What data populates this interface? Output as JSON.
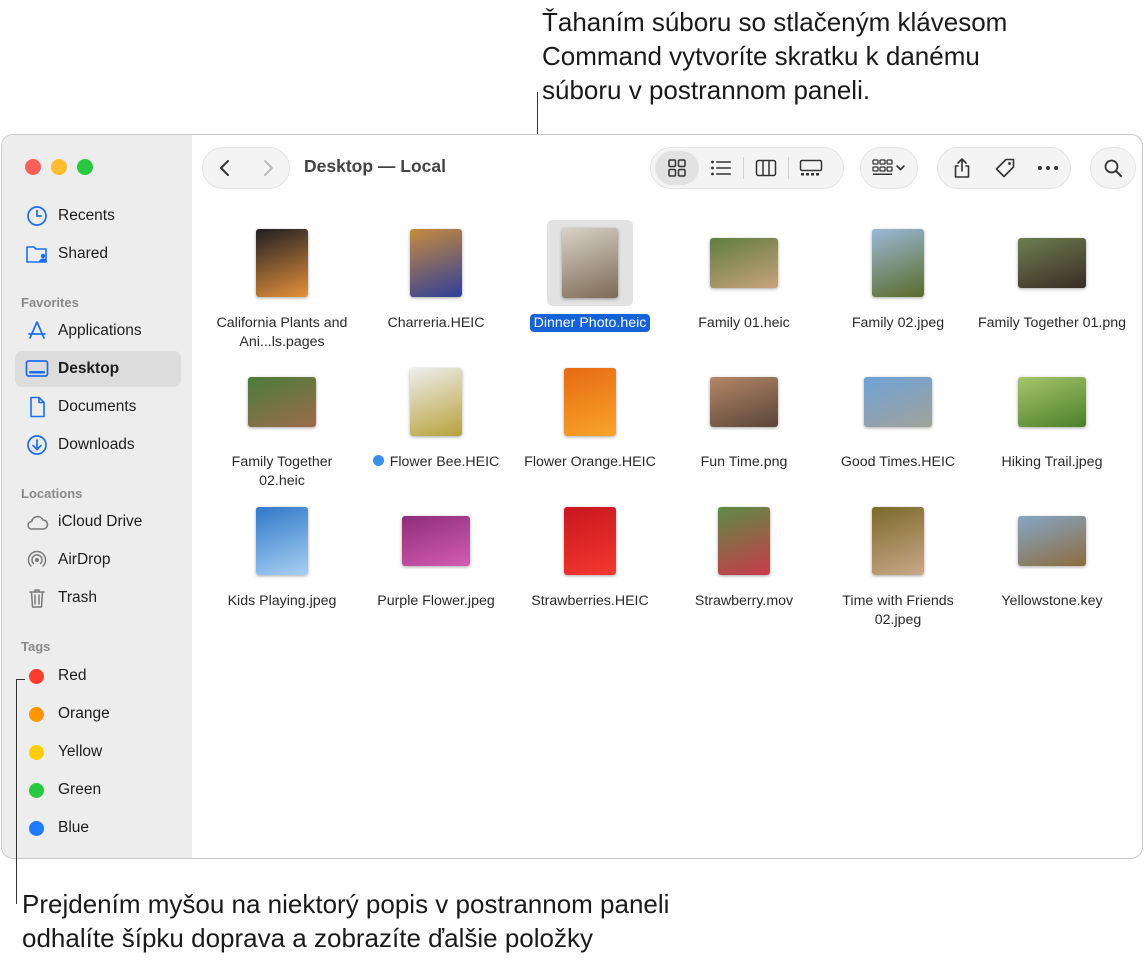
{
  "callouts": {
    "top": [
      "Ťahaním súboru so stlačeným klávesom",
      "Command vytvoríte skratku k danému",
      "súboru v postrannom paneli."
    ],
    "bottom": [
      "Prejdením myšou na niektorý popis v postrannom paneli",
      "odhalíte šípku doprava a zobrazíte ďalšie položky"
    ]
  },
  "window": {
    "title": "Desktop — Local",
    "traffic_lights": [
      "#fe5f57",
      "#febc2e",
      "#28c840"
    ]
  },
  "sidebar": {
    "top_items": [
      {
        "label": "Recents",
        "icon": "clock-icon"
      },
      {
        "label": "Shared",
        "icon": "shared-folder-icon"
      }
    ],
    "favorites_header": "Favorites",
    "favorites": [
      {
        "label": "Applications",
        "icon": "applications-icon"
      },
      {
        "label": "Desktop",
        "icon": "desktop-icon",
        "active": true
      },
      {
        "label": "Documents",
        "icon": "document-icon"
      },
      {
        "label": "Downloads",
        "icon": "downloads-icon"
      }
    ],
    "locations_header": "Locations",
    "locations": [
      {
        "label": "iCloud Drive",
        "icon": "cloud-icon"
      },
      {
        "label": "AirDrop",
        "icon": "airdrop-icon"
      },
      {
        "label": "Trash",
        "icon": "trash-icon"
      }
    ],
    "tags_header": "Tags",
    "tags": [
      {
        "label": "Red",
        "color": "#fe3b30"
      },
      {
        "label": "Orange",
        "color": "#ff9500"
      },
      {
        "label": "Yellow",
        "color": "#ffcc00"
      },
      {
        "label": "Green",
        "color": "#28c840"
      },
      {
        "label": "Blue",
        "color": "#1f7aff"
      }
    ]
  },
  "files": [
    {
      "name": "California Plants and Ani...ls.pages",
      "thumb_colors": [
        "#1e1e24",
        "#e6913a"
      ]
    },
    {
      "name": "Charreria.HEIC",
      "thumb_colors": [
        "#c78b3c",
        "#2f3f9a"
      ]
    },
    {
      "name": "Dinner Photo.heic",
      "selected": true,
      "thumb_colors": [
        "#d8d2c8",
        "#7c6a54"
      ]
    },
    {
      "name": "Family 01.heic",
      "thumb_colors": [
        "#5f7d3e",
        "#c9a27c"
      ]
    },
    {
      "name": "Family 02.jpeg",
      "thumb_colors": [
        "#9ab8d6",
        "#5a6b2a"
      ]
    },
    {
      "name": "Family Together 01.png",
      "thumb_colors": [
        "#6e7e50",
        "#3a2c25"
      ]
    },
    {
      "name": "Family Together 02.heic",
      "thumb_colors": [
        "#4b7c3a",
        "#9c6c4c"
      ]
    },
    {
      "name": "Flower Bee.HEIC",
      "tag_dot": true,
      "thumb_colors": [
        "#eeeeee",
        "#b7a23a"
      ]
    },
    {
      "name": "Flower Orange.HEIC",
      "thumb_colors": [
        "#e66a12",
        "#f8a529"
      ]
    },
    {
      "name": "Fun Time.png",
      "thumb_colors": [
        "#b38767",
        "#5a4538"
      ]
    },
    {
      "name": "Good Times.HEIC",
      "thumb_colors": [
        "#6ea2d8",
        "#a2a29a"
      ]
    },
    {
      "name": "Hiking Trail.jpeg",
      "thumb_colors": [
        "#a6c56a",
        "#4c7f2c"
      ]
    },
    {
      "name": "Kids Playing.jpeg",
      "thumb_colors": [
        "#3078c8",
        "#a8d0f2"
      ]
    },
    {
      "name": "Purple Flower.jpeg",
      "thumb_colors": [
        "#8c2e7c",
        "#d45cb0"
      ]
    },
    {
      "name": "Strawberries.HEIC",
      "thumb_colors": [
        "#c7161f",
        "#f4392f"
      ]
    },
    {
      "name": "Strawberry.mov",
      "thumb_colors": [
        "#5c8c46",
        "#c93a4a"
      ]
    },
    {
      "name": "Time with Friends 02.jpeg",
      "thumb_colors": [
        "#7a6a2a",
        "#c9a88a"
      ]
    },
    {
      "name": "Yellowstone.key",
      "thumb_colors": [
        "#86a6c6",
        "#8c6c3e"
      ]
    }
  ]
}
